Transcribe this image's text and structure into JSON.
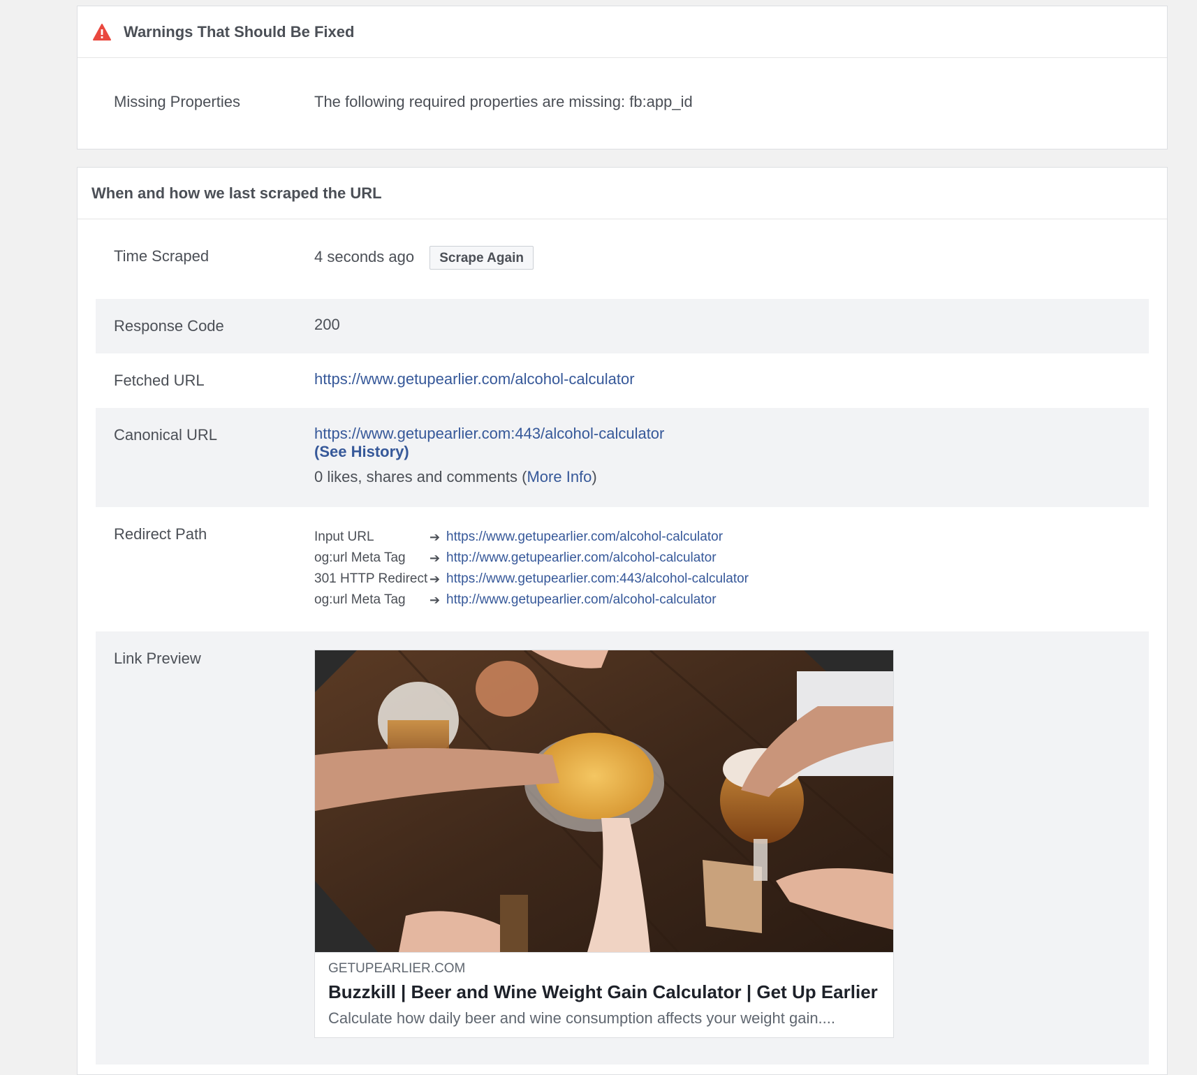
{
  "warnings": {
    "title": "Warnings That Should Be Fixed",
    "icon": "warning-triangle-icon",
    "icon_color": "#e9483f",
    "items": [
      {
        "label": "Missing Properties",
        "value": "The following required properties are missing: fb:app_id"
      }
    ]
  },
  "scrape": {
    "title": "When and how we last scraped the URL",
    "time_scraped": {
      "label": "Time Scraped",
      "value": "4 seconds ago",
      "button": "Scrape Again"
    },
    "response_code": {
      "label": "Response Code",
      "value": "200"
    },
    "fetched_url": {
      "label": "Fetched URL",
      "value": "https://www.getupearlier.com/alcohol-calculator"
    },
    "canonical_url": {
      "label": "Canonical URL",
      "value": "https://www.getupearlier.com:443/alcohol-calculator",
      "history_link": "(See History)",
      "engagement_prefix": "0 likes, shares and comments (",
      "more_info": "More Info",
      "engagement_suffix": ")"
    },
    "redirect_path": {
      "label": "Redirect Path",
      "rows": [
        {
          "type": "Input URL",
          "url": "https://www.getupearlier.com/alcohol-calculator"
        },
        {
          "type": "og:url Meta Tag",
          "url": "http://www.getupearlier.com/alcohol-calculator"
        },
        {
          "type": "301 HTTP Redirect",
          "url": "https://www.getupearlier.com:443/alcohol-calculator"
        },
        {
          "type": "og:url Meta Tag",
          "url": "http://www.getupearlier.com/alcohol-calculator"
        }
      ]
    },
    "link_preview": {
      "label": "Link Preview",
      "domain": "GETUPEARLIER.COM",
      "title": "Buzzkill | Beer and Wine Weight Gain Calculator | Get Up Earlier",
      "description": "Calculate how daily beer and wine consumption affects your weight gain...."
    }
  },
  "colors": {
    "link": "#365899",
    "shaded_row": "#f2f3f5",
    "page_bg": "#f1f1f1"
  }
}
